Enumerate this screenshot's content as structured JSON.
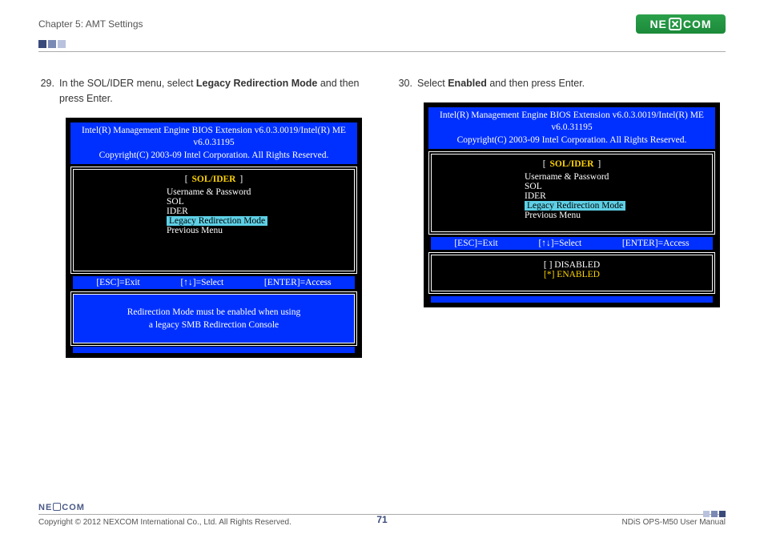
{
  "header": {
    "chapter": "Chapter 5: AMT Settings",
    "logo_text_left": "NE",
    "logo_text_right": "COM"
  },
  "steps": {
    "s29": {
      "num": "29.",
      "before": "In the SOL/IDER menu, select ",
      "bold": "Legacy Redirection Mode",
      "after": " and then press Enter."
    },
    "s30": {
      "num": "30.",
      "before": "Select ",
      "bold": "Enabled",
      "after": " and then press Enter."
    }
  },
  "bios": {
    "title_line1": "Intel(R) Management Engine BIOS Extension v6.0.3.0019/Intel(R) ME v6.0.31195",
    "title_line2": "Copyright(C) 2003-09 Intel Corporation. All Rights Reserved.",
    "section_bracket_open": "[",
    "section_bracket_close": "]",
    "section_title": "SOL/IDER",
    "items": {
      "userpass": "Username & Password",
      "sol": "SOL",
      "ider": "IDER",
      "legacy": "Legacy Redirection Mode",
      "prev": "Previous Menu"
    },
    "nav": {
      "esc": "[ESC]=Exit",
      "sel": "[↑↓]=Select",
      "enter": "[ENTER]=Access"
    },
    "msg_line1": "Redirection Mode must be enabled when using",
    "msg_line2": "a legacy SMB Redirection Console",
    "opts": {
      "disabled": "[  ] DISABLED",
      "enabled": "[*] ENABLED"
    }
  },
  "footer": {
    "copyright": "Copyright © 2012 NEXCOM International Co., Ltd. All Rights Reserved.",
    "page": "71",
    "manual": "NDiS OPS-M50 User Manual",
    "logo_left": "NE",
    "logo_right": "COM"
  }
}
